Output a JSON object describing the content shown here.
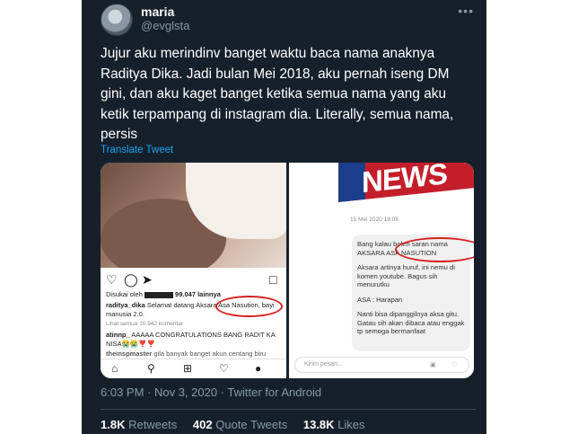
{
  "author": {
    "name": "maria",
    "handle": "@evglsta"
  },
  "more_label": "•••",
  "tweet": {
    "text": "Jujur aku merindinv banget waktu baca nama anaknya Raditya Dika. Jadi bulan Mei 2018, aku pernah iseng DM gini, dan aku kaget banget ketika semua nama yang aku ketik terpampang di instagram dia. Literally, semua nama, persis",
    "translate_label": "Translate Tweet",
    "timestamp": "6:03 PM · Nov 3, 2020 · Twitter for Android"
  },
  "instagram": {
    "liked_by": "Disukai oleh",
    "liked_count": "99.047 lainnya",
    "caption_user": "raditya_dika",
    "caption_text": "Selamat datang Aksara Asa Nasution, bayi",
    "caption_text2": "manusia 2.0.",
    "view_comments": "Lihat semua 10.942 komentar",
    "comment1_user": "atinnp_",
    "comment1_text": "AAAAA CONGRATULATIONS BANG RADIT KA",
    "comment1_text2": "NISA😭😭❣️❣️",
    "comment2_user": "theinspmaster",
    "comment2_text": "gila banyak banget akun centang biru"
  },
  "dm": {
    "banner": "NEWS",
    "time": "15 Mei 2020 19:08",
    "msg1": "Bang kalau boleh saran nama",
    "msg1b": "AKSARA ASA NASUTION",
    "msg2": "Aksara artinya huruf, ini nemu di komen youtube. Bagus sih menurutku",
    "msg3": "ASA : Harapan",
    "msg4": "Nanti bisa dipanggilnya aksa gitu. Gatau sih akan dibaca atau enggak tp semoga bermanfaat",
    "input_placeholder": "Kirim pesan..."
  },
  "stats": {
    "retweets_count": "1.8K",
    "retweets_label": "Retweets",
    "quotes_count": "402",
    "quotes_label": "Quote Tweets",
    "likes_count": "13.8K",
    "likes_label": "Likes"
  }
}
